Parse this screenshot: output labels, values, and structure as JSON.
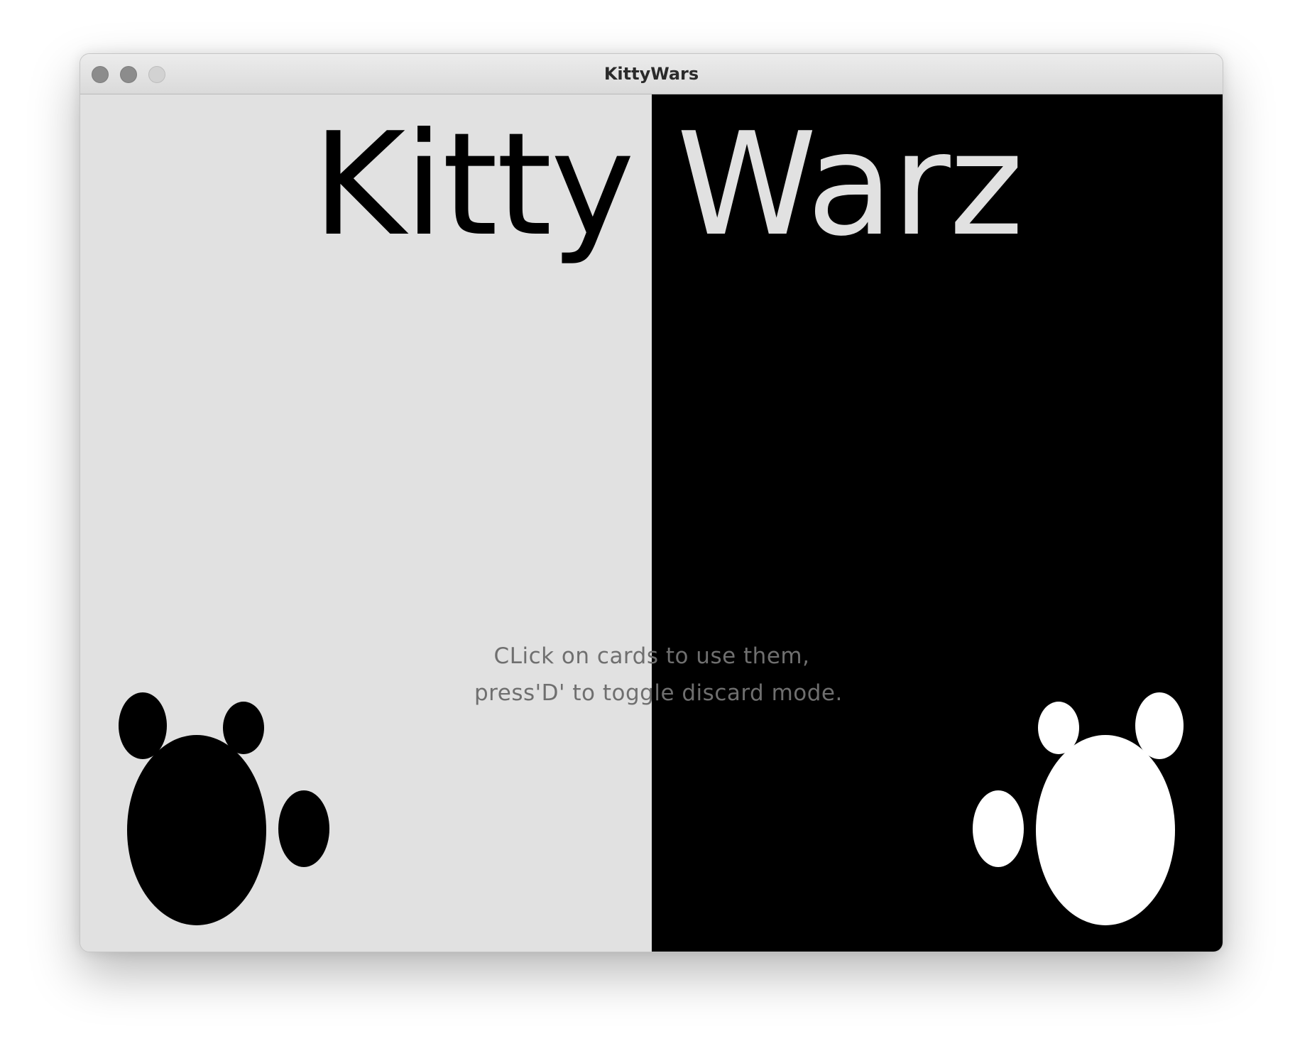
{
  "window": {
    "title": "KittyWars"
  },
  "game": {
    "title_left": "Kitty",
    "title_right": "Warz",
    "instructions": [
      "CLick on cards to use them,",
      "press'D' to toggle discard mode."
    ]
  },
  "colors": {
    "left_panel": "#e1e1e1",
    "right_panel": "#000000",
    "left_paw": "#000000",
    "right_paw": "#ffffff",
    "instruction_text": "#6f6f6f"
  },
  "icons": {
    "left": "paw-print-icon",
    "right": "paw-print-icon"
  }
}
